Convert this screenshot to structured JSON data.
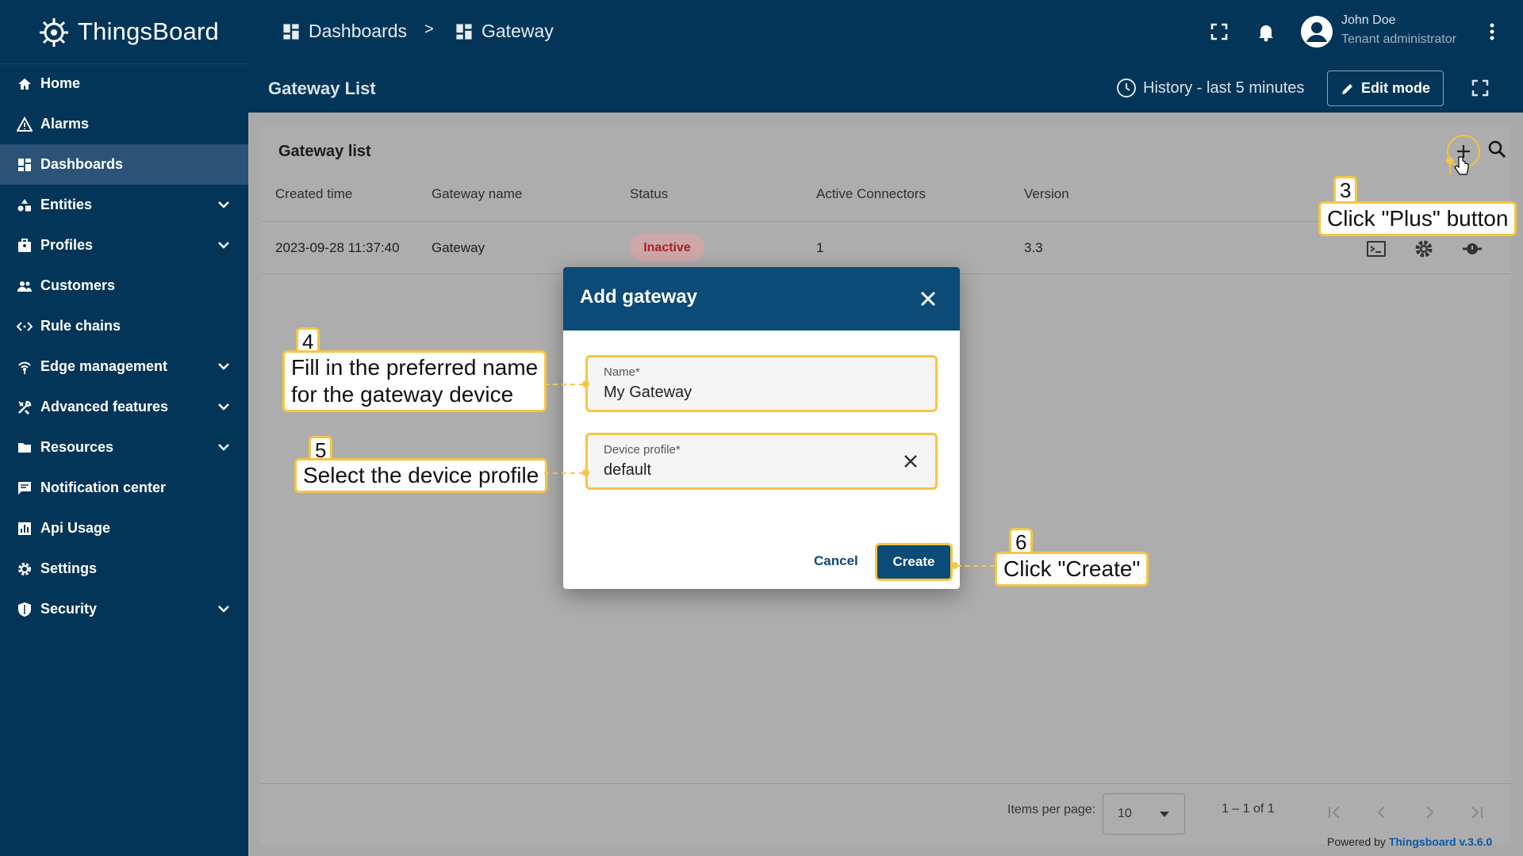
{
  "app": {
    "brand": "ThingsBoard"
  },
  "sidebar": {
    "items": [
      {
        "label": "Home",
        "icon": "home-icon"
      },
      {
        "label": "Alarms",
        "icon": "warning-icon"
      },
      {
        "label": "Dashboards",
        "icon": "dashboard-icon",
        "active": true
      },
      {
        "label": "Entities",
        "icon": "entities-icon",
        "expandable": true
      },
      {
        "label": "Profiles",
        "icon": "profiles-icon",
        "expandable": true
      },
      {
        "label": "Customers",
        "icon": "customers-icon"
      },
      {
        "label": "Rule chains",
        "icon": "rule-chain-icon"
      },
      {
        "label": "Edge management",
        "icon": "edge-icon",
        "expandable": true
      },
      {
        "label": "Advanced features",
        "icon": "tools-icon",
        "expandable": true
      },
      {
        "label": "Resources",
        "icon": "folder-icon",
        "expandable": true
      },
      {
        "label": "Notification center",
        "icon": "notification-icon"
      },
      {
        "label": "Api Usage",
        "icon": "chart-icon"
      },
      {
        "label": "Settings",
        "icon": "gear-icon"
      },
      {
        "label": "Security",
        "icon": "shield-icon",
        "expandable": true
      }
    ]
  },
  "topbar": {
    "breadcrumb": [
      {
        "label": "Dashboards"
      },
      {
        "label": "Gateway"
      }
    ],
    "separator": ">",
    "user": {
      "name": "John Doe",
      "role": "Tenant administrator"
    }
  },
  "dashboard": {
    "title": "Gateway List",
    "history": "History - last 5 minutes",
    "edit_mode": "Edit mode"
  },
  "widget": {
    "title": "Gateway list",
    "columns": [
      "Created time",
      "Gateway name",
      "Status",
      "Active Connectors",
      "Version"
    ],
    "rows": [
      {
        "created": "2023-09-28 11:37:40",
        "name": "Gateway",
        "status": "Inactive",
        "connectors": "1",
        "version": "3.3"
      }
    ],
    "pager": {
      "items_per_page_label": "Items per page:",
      "items_per_page": "10",
      "range": "1 – 1 of 1"
    },
    "powered_by": "Powered by",
    "powered_version": "Thingsboard v.3.6.0"
  },
  "dialog": {
    "title": "Add gateway",
    "name_label": "Name*",
    "name_value": "My Gateway",
    "profile_label": "Device profile*",
    "profile_value": "default",
    "cancel": "Cancel",
    "create": "Create"
  },
  "annotations": {
    "step3": {
      "num": "3",
      "text": "Click \"Plus\" button"
    },
    "step4": {
      "num": "4",
      "line1": "Fill in the preferred name",
      "line2": "for the gateway device"
    },
    "step5": {
      "num": "5",
      "text": "Select the device profile"
    },
    "step6": {
      "num": "6",
      "text": "Click \"Create\""
    }
  },
  "colors": {
    "sidebar": "#033558",
    "accent": "#f6c543",
    "primary": "#0c4a78",
    "inactive": "#a3232e"
  }
}
